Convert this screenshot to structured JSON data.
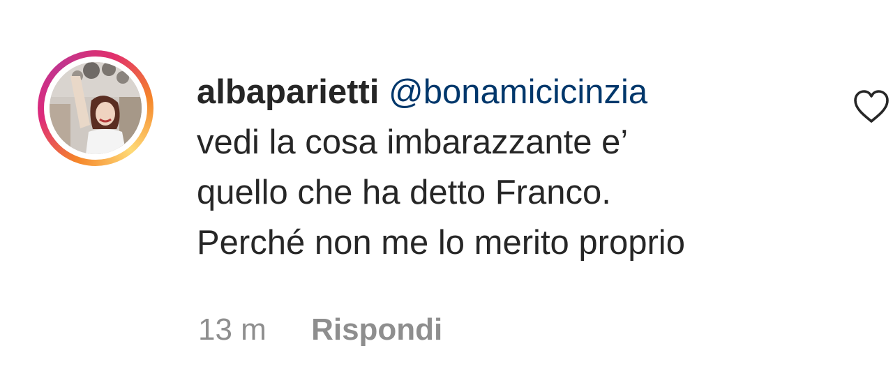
{
  "comment": {
    "username": "albaparietti",
    "mention": "@bonamicicinzia",
    "text_lines": [
      "vedi la cosa imbarazzante e’",
      "quello che ha detto Franco.",
      "Perché non me lo merito proprio"
    ],
    "timestamp": "13 m",
    "reply_label": "Rispondi",
    "like_icon": "heart-outline-icon"
  },
  "colors": {
    "username": "#262626",
    "mention": "#00376b",
    "meta": "#8e8e8e",
    "story_ring": [
      "#f58529",
      "#dd2a7b",
      "#feda77"
    ]
  }
}
